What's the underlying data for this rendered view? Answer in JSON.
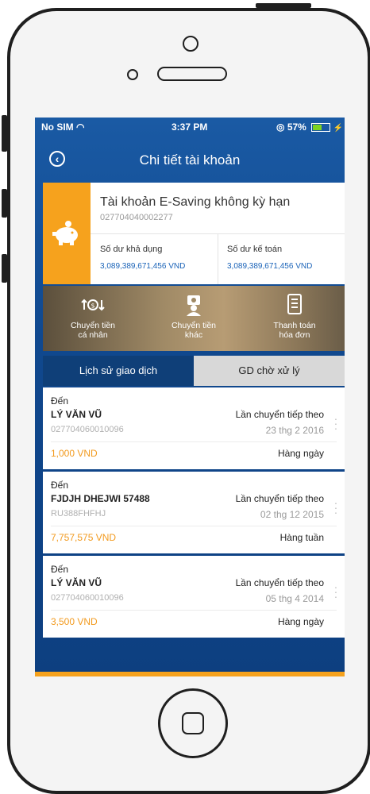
{
  "status_bar": {
    "carrier": "No SIM",
    "time": "3:37 PM",
    "battery": "57%",
    "battery_level": 0.57
  },
  "header": {
    "title": "Chi tiết tài khoản"
  },
  "account": {
    "name": "Tài khoản E-Saving không kỳ hạn",
    "number": "027704040002277",
    "available_label": "Số dư khả dụng",
    "available_value": "3,089,389,671,456 VND",
    "ledger_label": "Số dư kế toán",
    "ledger_value": "3,089,389,671,456 VND"
  },
  "actions": [
    {
      "line1": "Chuyển tiền",
      "line2": "cá nhân",
      "icon": "transfer-personal-icon"
    },
    {
      "line1": "Chuyển tiền",
      "line2": "khác",
      "icon": "transfer-other-icon"
    },
    {
      "line1": "Thanh toán",
      "line2": "hóa đơn",
      "icon": "bill-payment-icon"
    }
  ],
  "tabs": [
    {
      "label": "Lịch sử giao dịch"
    },
    {
      "label": "GD chờ xử lý"
    }
  ],
  "transactions": [
    {
      "direction": "Đến",
      "name": "LÝ VĂN VŨ",
      "account": "027704060010096",
      "next_label": "Lần chuyển tiếp theo",
      "date": "23 thg 2 2016",
      "amount": "1,000 VND",
      "frequency": "Hàng ngày"
    },
    {
      "direction": "Đến",
      "name": "FJDJH DHEJWI 57488",
      "account": "RU388FHFHJ",
      "next_label": "Lần chuyển tiếp theo",
      "date": "02 thg 12 2015",
      "amount": "7,757,575 VND",
      "frequency": "Hàng tuần"
    },
    {
      "direction": "Đến",
      "name": "LÝ VĂN VŨ",
      "account": "027704060010096",
      "next_label": "Lần chuyển tiếp theo",
      "date": "05 thg 4 2014",
      "amount": "3,500 VND",
      "frequency": "Hàng ngày"
    }
  ],
  "colors": {
    "primary_blue": "#1a5aa4",
    "accent_orange": "#f6a21d",
    "link_blue": "#1a63b8"
  }
}
